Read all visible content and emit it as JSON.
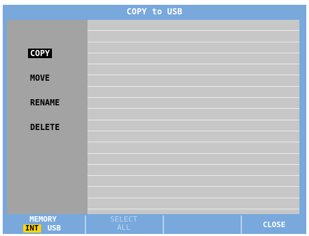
{
  "window": {
    "title": "COPY to USB"
  },
  "menu": {
    "items": [
      {
        "label": "COPY",
        "selected": true
      },
      {
        "label": "MOVE",
        "selected": false
      },
      {
        "label": "RENAME",
        "selected": false
      },
      {
        "label": "DELETE",
        "selected": false
      }
    ]
  },
  "file_list": {
    "rows": 17
  },
  "softkeys": {
    "memory": {
      "label": "MEMORY",
      "options": [
        "INT",
        "USB"
      ],
      "active": "INT"
    },
    "select_all": {
      "line1": "SELECT",
      "line2": "ALL",
      "enabled": false
    },
    "blank": {
      "label": ""
    },
    "close": {
      "label": "CLOSE"
    }
  },
  "colors": {
    "background": "#78a8dc",
    "menu_panel": "#a3a3a3",
    "file_panel": "#c7c7c7",
    "highlight": "#ffd600"
  }
}
